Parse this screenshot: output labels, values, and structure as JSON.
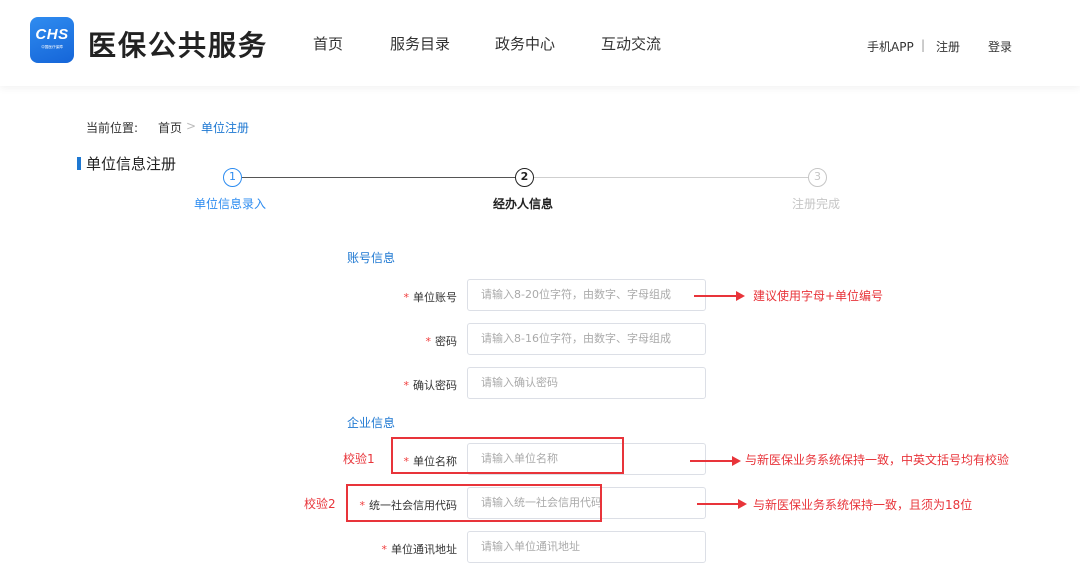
{
  "header": {
    "logo_abbr": "CHS",
    "logo_sub": "中国医疗保障",
    "site_title": "医保公共服务",
    "nav": [
      "首页",
      "服务目录",
      "政务中心",
      "互动交流"
    ],
    "mobile_app": "手机APP",
    "separator": "|",
    "register": "注册",
    "login": "登录",
    "brand_color": "#1e78d2"
  },
  "breadcrumb": {
    "label": "当前位置:",
    "home": "首页",
    "arrow": ">",
    "current": "单位注册"
  },
  "section": {
    "title": "单位信息注册"
  },
  "steps": [
    {
      "number": "1",
      "label": "单位信息录入",
      "state": "done"
    },
    {
      "number": "2",
      "label": "经办人信息",
      "state": "active"
    },
    {
      "number": "3",
      "label": "注册完成",
      "state": "pending"
    }
  ],
  "form": {
    "account_title": "账号信息",
    "company_title": "企业信息",
    "required_mark": "*",
    "fields": [
      {
        "label": "单位账号",
        "placeholder": "请输入8-20位字符，由数字、字母组成",
        "value": ""
      },
      {
        "label": "密码",
        "placeholder": "请输入8-16位字符，由数字、字母组成",
        "value": ""
      },
      {
        "label": "确认密码",
        "placeholder": "请输入确认密码",
        "value": ""
      },
      {
        "label": "单位名称",
        "placeholder": "请输入单位名称",
        "value": ""
      },
      {
        "label": "统一社会信用代码",
        "placeholder": "请输入统一社会信用代码",
        "value": ""
      },
      {
        "label": "单位通讯地址",
        "placeholder": "请输入单位通讯地址",
        "value": ""
      }
    ]
  },
  "annotations": {
    "check1_label": "校验1",
    "check2_label": "校验2",
    "note_account": "建议使用字母+单位编号",
    "note_name": "与新医保业务系统保持一致，中英文括号均有校验",
    "note_credit": "与新医保业务系统保持一致，且须为18位",
    "color": "#e8343a"
  }
}
